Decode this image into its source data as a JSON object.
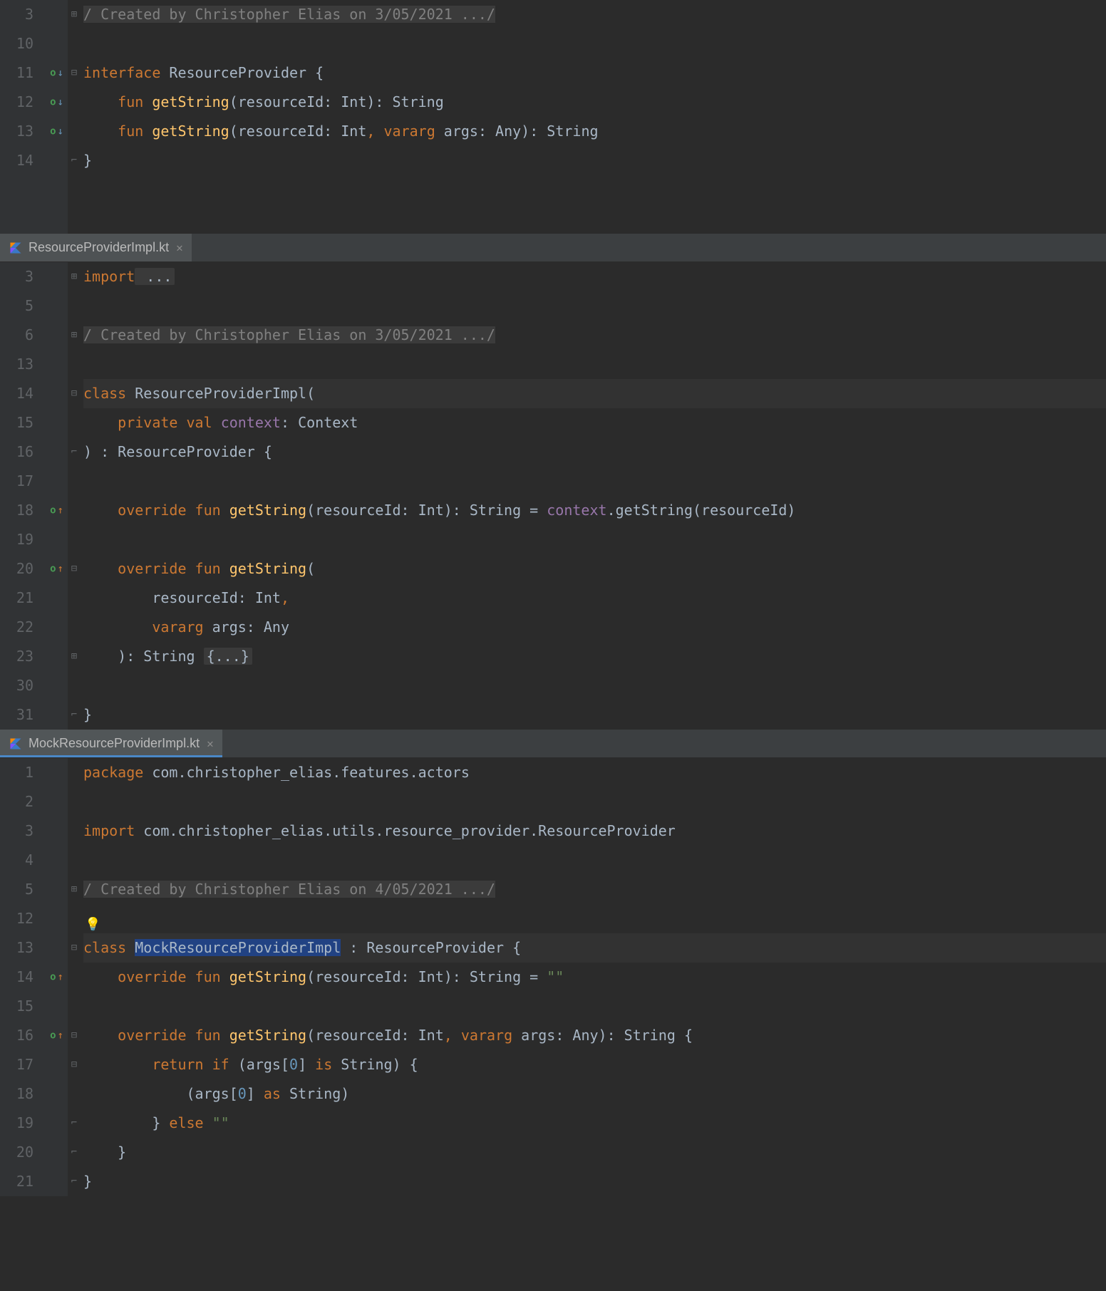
{
  "tabs": {
    "impl": {
      "label": "ResourceProviderImpl.kt"
    },
    "mock": {
      "label": "MockResourceProviderImpl.kt"
    }
  },
  "pane1": {
    "lines": [
      "3",
      "10",
      "11",
      "12",
      "13",
      "14",
      "",
      ""
    ],
    "comment": "/ Created by Christopher Elias on 3/05/2021 .../",
    "l11": {
      "kw1": "interface",
      "name": "ResourceProvider",
      "brace": " {"
    },
    "l12": {
      "kw1": "fun",
      "fn": "getString",
      "p1": "(resourceId: ",
      "ty1": "Int",
      "p2": "): ",
      "ty2": "String"
    },
    "l13": {
      "kw1": "fun",
      "fn": "getString",
      "p1": "(resourceId: ",
      "ty1": "Int",
      "comma": ", ",
      "kw2": "vararg",
      "p2": " args: ",
      "ty2": "Any",
      "p3": "): ",
      "ty3": "String"
    },
    "l14": "}"
  },
  "pane2": {
    "lines": [
      "3",
      "5",
      "6",
      "13",
      "14",
      "15",
      "16",
      "17",
      "18",
      "19",
      "20",
      "21",
      "22",
      "23",
      "30",
      "31"
    ],
    "l3": {
      "kw": "import",
      "ell": " ..."
    },
    "comment": "/ Created by Christopher Elias on 3/05/2021 .../",
    "l14": {
      "kw": "class",
      "name": " ResourceProviderImpl("
    },
    "l15": {
      "kw1": "private",
      "kw2": "val",
      "pr": "context",
      "colon": ": ",
      "ty": "Context"
    },
    "l16": {
      "txt": ") : ResourceProvider {"
    },
    "l18": {
      "kw1": "override",
      "kw2": "fun",
      "fn": "getString",
      "p1": "(resourceId: ",
      "ty1": "Int",
      "p2": "): ",
      "ty2": "String",
      "eq": " = ",
      "pr": "context",
      "dot": ".",
      "call": "getString",
      "p3": "(resourceId)"
    },
    "l20": {
      "kw1": "override",
      "kw2": "fun",
      "fn": "getString",
      "p": "("
    },
    "l21": {
      "p": "resourceId: ",
      "ty": "Int",
      "comma": ","
    },
    "l22": {
      "kw": "vararg",
      "p": " args: ",
      "ty": "Any"
    },
    "l23": {
      "p1": "): ",
      "ty": "String",
      "sp": " ",
      "fold": "{...}"
    },
    "l31": "}"
  },
  "pane3": {
    "lines": [
      "1",
      "2",
      "3",
      "4",
      "5",
      "12",
      "13",
      "14",
      "15",
      "16",
      "17",
      "18",
      "19",
      "20",
      "21"
    ],
    "l1": {
      "kw": "package",
      "pkg": " com.christopher_elias.features.actors"
    },
    "l3": {
      "kw": "import",
      "pkg": " com.christopher_elias.utils.resource_provider.ResourceProvider"
    },
    "comment": "/ Created by Christopher Elias on 4/05/2021 .../",
    "l13": {
      "kw": "class",
      "name": "MockResourceProviderImpl",
      "rest": " : ResourceProvider {"
    },
    "l14": {
      "kw1": "override",
      "kw2": "fun",
      "fn": "getString",
      "p1": "(resourceId: ",
      "ty1": "Int",
      "p2": "): ",
      "ty2": "String",
      "eq": " = ",
      "str": "\"\""
    },
    "l16": {
      "kw1": "override",
      "kw2": "fun",
      "fn": "getString",
      "p1": "(resourceId: ",
      "ty1": "Int",
      "comma": ", ",
      "kw3": "vararg",
      "p2": " args: ",
      "ty2": "Any",
      "p3": "): ",
      "ty3": "String",
      "brace": " {"
    },
    "l17": {
      "kw1": "return",
      "kw2": "if",
      "p1": " (args[",
      "num": "0",
      "p2": "] ",
      "kw3": "is",
      "ty": " String",
      "p3": ") {"
    },
    "l18": {
      "p1": "(args[",
      "num": "0",
      "p2": "] ",
      "kw": "as",
      "ty": " String",
      "p3": ")"
    },
    "l19": {
      "p1": "} ",
      "kw": "else",
      "sp": " ",
      "str": "\"\""
    },
    "l20": "}",
    "l21": "}"
  }
}
